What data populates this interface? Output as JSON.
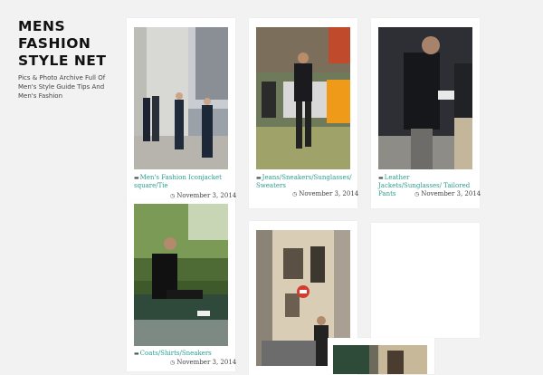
{
  "site": {
    "title": "MENS FASHION STYLE NET",
    "description": "Pics & Photo Archive Full Of Men's Style Guide Tips And Men's Fashion"
  },
  "posts": [
    {
      "categories": "Men's Fashion Iconjacket square/Tie",
      "date": "November 3, 2014"
    },
    {
      "categories": "Jeans/Sneakers/Sunglasses/ Sweaters",
      "date": "November 3, 2014"
    },
    {
      "categories": "Leather Jackets/Sunglasses/ Tailored Pants",
      "date": "November 3, 2014"
    },
    {
      "categories": "Coats/Shirts/Sneakers",
      "date": "November 3, 2014"
    }
  ],
  "icons": {
    "folder": "folder-icon",
    "clock": "clock-icon"
  }
}
